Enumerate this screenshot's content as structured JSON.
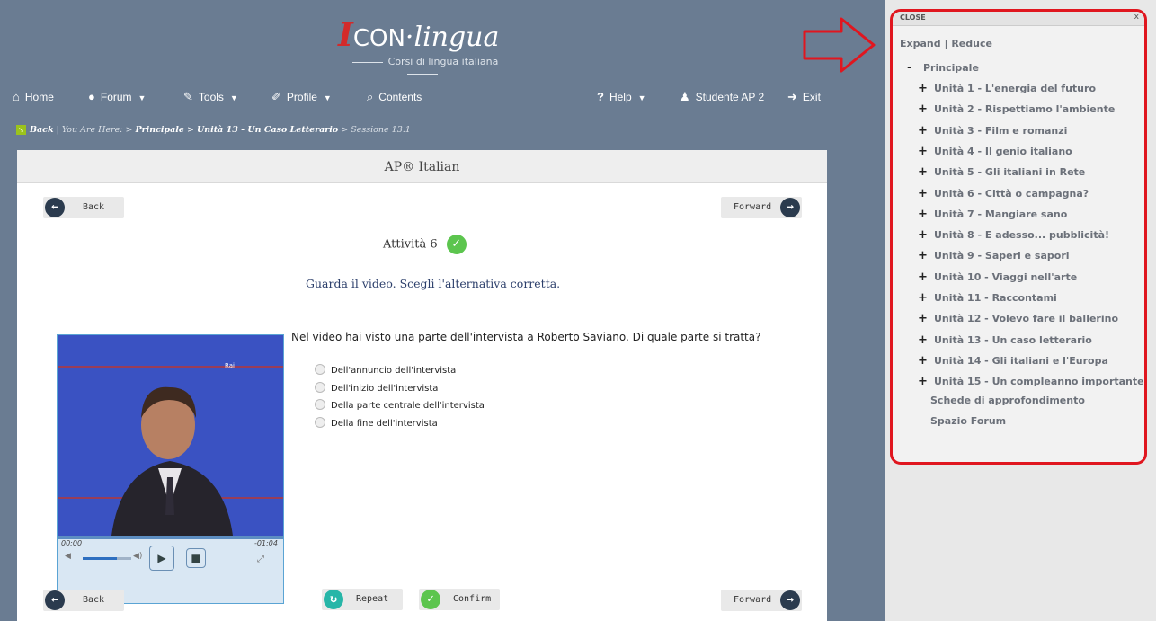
{
  "header": {
    "logo_mark": "I",
    "logo_icon": "CON",
    "logo_dot": "·",
    "logo_lingua": "lingua",
    "tagline": "Corsi di lingua italiana"
  },
  "nav": {
    "home": "Home",
    "forum": "Forum",
    "tools": "Tools",
    "profile": "Profile",
    "contents": "Contents",
    "help": "Help",
    "user": "Studente AP 2",
    "exit": "Exit"
  },
  "breadcrumb": {
    "back": "Back",
    "sep": " | ",
    "here": "You Are Here: > ",
    "principale": "Principale",
    "gt1": " > ",
    "unit": "Unità 13 - Un Caso Letterario",
    "gt2": " > ",
    "session": "Sessione 13.1"
  },
  "panel": {
    "title": "AP® Italian",
    "back_label": "Back",
    "forward_label": "Forward",
    "activity": "Attività 6",
    "instruction": "Guarda il video. Scegli l'alternativa corretta.",
    "question": "Nel video hai visto una parte dell'intervista a Roberto Saviano. Di quale parte si tratta?",
    "options": [
      "Dell'annuncio dell'intervista",
      "Dell'inizio dell'intervista",
      "Della parte centrale dell'intervista",
      "Della fine dell'intervista"
    ],
    "repeat_label": "Repeat",
    "confirm_label": "Confirm"
  },
  "video": {
    "time_current": "00:00",
    "time_remaining": "-01:04",
    "volume_level": 0.7
  },
  "sidebar": {
    "close": "CLOSE",
    "close_x": "x",
    "expand": "Expand",
    "pipe": " | ",
    "reduce": "Reduce",
    "root": "Principale",
    "units": [
      "Unità 1 - L'energia del futuro",
      "Unità 2 - Rispettiamo l'ambiente",
      "Unità 3 - Film e romanzi",
      "Unità 4 - Il genio italiano",
      "Unità 5 - Gli italiani in Rete",
      "Unità 6 - Città o campagna?",
      "Unità 7 - Mangiare sano",
      "Unità 8 - E adesso... pubblicità!",
      "Unità 9 - Saperi e sapori",
      "Unità 10 - Viaggi nell'arte",
      "Unità 11 - Raccontami",
      "Unità 12 - Volevo fare il ballerino",
      "Unità 13 - Un caso letterario",
      "Unità 14 - Gli italiani e l'Europa",
      "Unità 15 - Un compleanno importante"
    ],
    "extras": [
      "Schede di approfondimento",
      "Spazio Forum"
    ]
  },
  "colors": {
    "header_bg": "#6a7c92",
    "highlight": "#e0161f",
    "accent_green": "#5cc54e",
    "accent_teal": "#27b6a8"
  }
}
